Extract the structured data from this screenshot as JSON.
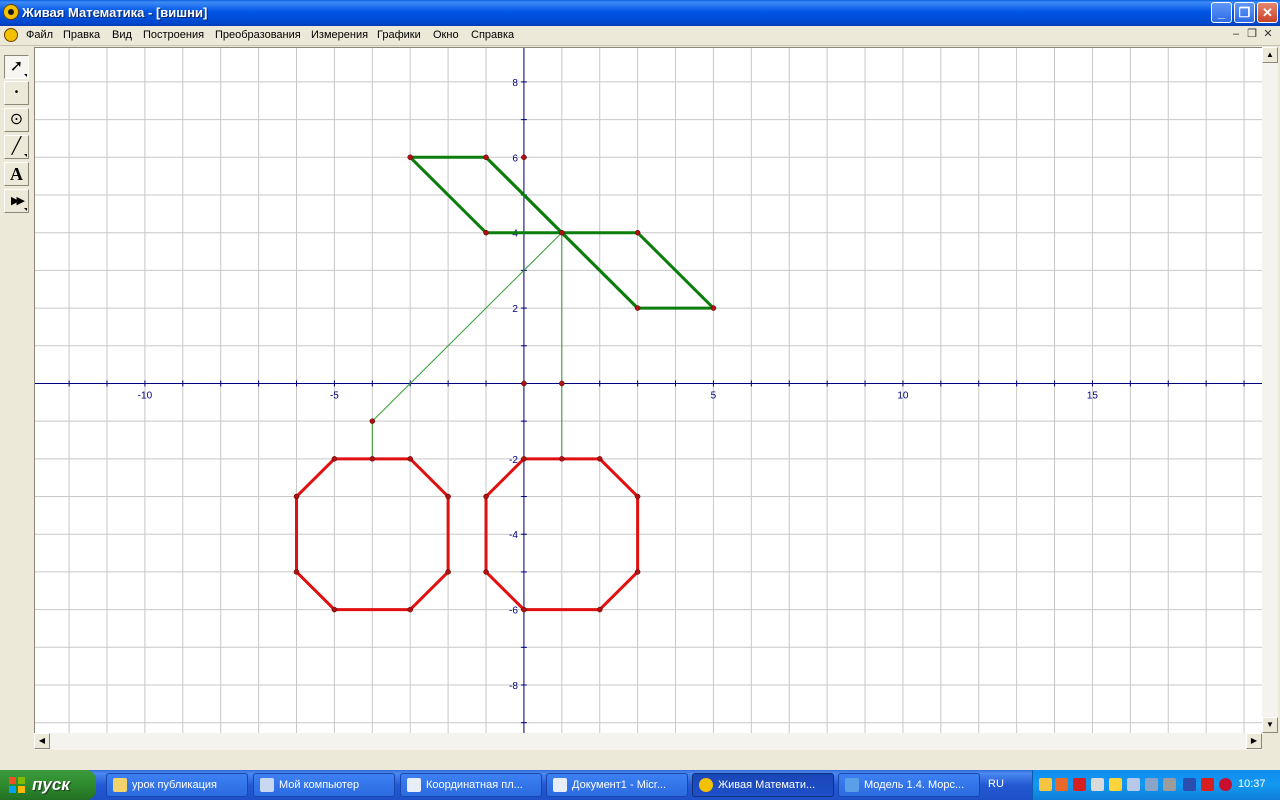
{
  "window": {
    "title": "Живая Математика - [вишни]"
  },
  "menu": [
    "Файл",
    "Правка",
    "Вид",
    "Построения",
    "Преобразования",
    "Измерения",
    "Графики",
    "Окно",
    "Справка"
  ],
  "tools": [
    {
      "name": "arrow-tool",
      "glyph": "➚"
    },
    {
      "name": "point-tool",
      "glyph": "•"
    },
    {
      "name": "compass-tool",
      "glyph": "⊙"
    },
    {
      "name": "straightedge-tool",
      "glyph": "╱"
    },
    {
      "name": "text-tool",
      "glyph": "A"
    },
    {
      "name": "custom-tool",
      "glyph": "▶▶"
    }
  ],
  "axes": {
    "x_ticks": [
      "-10",
      "-5",
      "5",
      "10",
      "15"
    ],
    "y_ticks": [
      "8",
      "6",
      "2",
      "-2",
      "-4",
      "-6",
      "-8"
    ],
    "y_tick_4": "4",
    "x_range": [
      -12.9,
      19.5
    ],
    "y_range": [
      -9.3,
      8.9
    ],
    "grid": true
  },
  "drawing": {
    "colors": {
      "leaf": "#0A7D0A",
      "cherry": "#E01010",
      "stem": "#2E9B2E",
      "point": "#B01010",
      "axis": "#000080"
    },
    "leaves": [
      [
        [
          -3,
          6
        ],
        [
          -1,
          6
        ],
        [
          1,
          4
        ],
        [
          -1,
          4
        ]
      ],
      [
        [
          1,
          4
        ],
        [
          3,
          4
        ],
        [
          5,
          2
        ],
        [
          3,
          2
        ]
      ]
    ],
    "leaf_diagonal": [
      [
        -1,
        6
      ],
      [
        3,
        2
      ]
    ],
    "stems": [
      [
        [
          1,
          4
        ],
        [
          1,
          -2
        ]
      ],
      [
        [
          1,
          4
        ],
        [
          -4,
          -1
        ]
      ],
      [
        [
          -4,
          -1
        ],
        [
          -4,
          -2
        ]
      ]
    ],
    "cherries": [
      [
        [
          -5,
          -2
        ],
        [
          -3,
          -2
        ],
        [
          -2,
          -3
        ],
        [
          -2,
          -5
        ],
        [
          -3,
          -6
        ],
        [
          -5,
          -6
        ],
        [
          -6,
          -5
        ],
        [
          -6,
          -3
        ]
      ],
      [
        [
          0,
          -2
        ],
        [
          2,
          -2
        ],
        [
          3,
          -3
        ],
        [
          3,
          -5
        ],
        [
          2,
          -6
        ],
        [
          0,
          -6
        ],
        [
          -1,
          -5
        ],
        [
          -1,
          -3
        ]
      ]
    ],
    "points": [
      [
        0,
        6
      ],
      [
        0,
        0
      ],
      [
        1,
        0
      ],
      [
        -3,
        6
      ],
      [
        -1,
        6
      ],
      [
        -1,
        4
      ],
      [
        1,
        4
      ],
      [
        3,
        4
      ],
      [
        3,
        2
      ],
      [
        5,
        2
      ],
      [
        -4,
        -1
      ],
      [
        -4,
        -2
      ],
      [
        1,
        -2
      ],
      [
        -5,
        -2
      ],
      [
        -3,
        -2
      ],
      [
        -2,
        -3
      ],
      [
        -2,
        -5
      ],
      [
        -3,
        -6
      ],
      [
        -5,
        -6
      ],
      [
        -6,
        -5
      ],
      [
        -6,
        -3
      ],
      [
        0,
        -2
      ],
      [
        2,
        -2
      ],
      [
        3,
        -3
      ],
      [
        3,
        -5
      ],
      [
        2,
        -6
      ],
      [
        0,
        -6
      ],
      [
        -1,
        -5
      ],
      [
        -1,
        -3
      ]
    ]
  },
  "taskbar": {
    "start_label": "пуск",
    "tasks": [
      {
        "label": "урок публикация",
        "icon": "folder-icon",
        "color": "#F3D36B"
      },
      {
        "label": "Мой компьютер",
        "icon": "computer-icon",
        "color": "#C8D8F0"
      },
      {
        "label": "Координатная пл...",
        "icon": "word-doc-icon",
        "color": "#E8EEF8"
      },
      {
        "label": "Документ1 - Micr...",
        "icon": "word-doc-icon",
        "color": "#E8EEF8"
      },
      {
        "label": "Живая Математи...",
        "icon": "sketchpad-icon",
        "color": "#F2C200"
      },
      {
        "label": "Модель 1.4. Морс...",
        "icon": "ie-icon",
        "color": "#5AA0E8"
      }
    ],
    "language": "RU",
    "clock": "10:37"
  }
}
